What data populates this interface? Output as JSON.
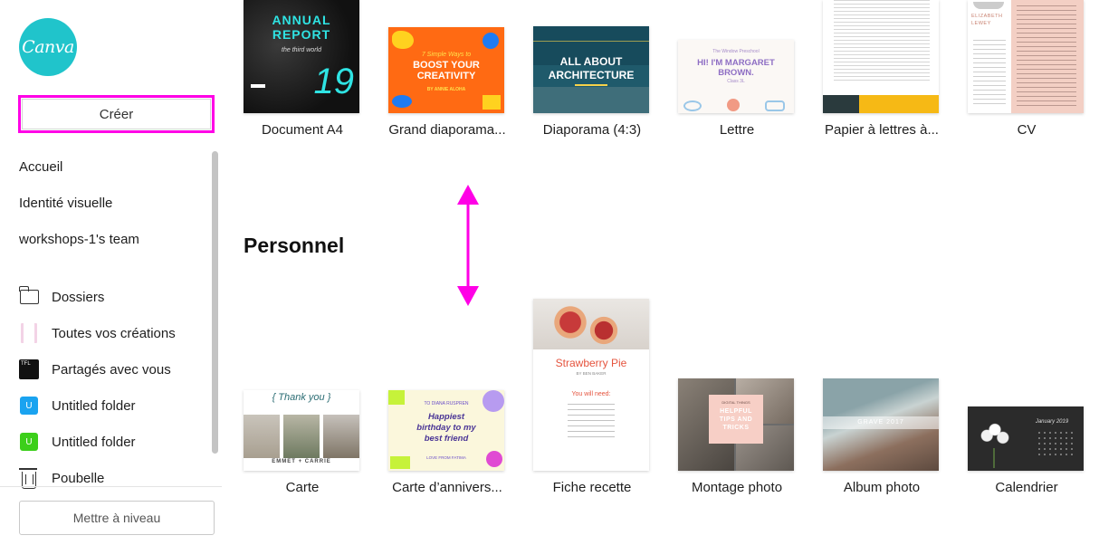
{
  "sidebar": {
    "logo_text": "Canva",
    "create_label": "Créer",
    "nav_top": [
      "Accueil",
      "Identité visuelle",
      "workshops-1's team"
    ],
    "folders": [
      {
        "label": "Dossiers",
        "icon": "folder-icon"
      },
      {
        "label": "Toutes vos créations",
        "icon": "all-designs-icon"
      },
      {
        "label": "Partagés avec vous",
        "icon": "shared-icon"
      },
      {
        "label": "Untitled folder",
        "icon": "folder-u-blue-icon",
        "badge": "U"
      },
      {
        "label": "Untitled folder",
        "icon": "folder-u-green-icon",
        "badge": "U"
      },
      {
        "label": "Poubelle",
        "icon": "trash-icon"
      }
    ],
    "upgrade_label": "Mettre à niveau"
  },
  "main": {
    "top_row": [
      {
        "label": "Document A4",
        "thumb": {
          "line1": "ANNUAL",
          "line2": "REPORT",
          "line3": "the third world",
          "number": "19"
        }
      },
      {
        "label": "Grand diaporama...",
        "thumb": {
          "line1": "7 Simple Ways to",
          "line2": "BOOST YOUR CREATIVITY",
          "line3": "BY ANNIE ALOHA"
        }
      },
      {
        "label": "Diaporama (4:3)",
        "thumb": {
          "line1": "ALL ABOUT ARCHITECTURE"
        }
      },
      {
        "label": "Lettre",
        "thumb": {
          "line1": "The Window Preschool",
          "line2": "HI! I'M MARGARET BROWN.",
          "line3": "Class 3L"
        }
      },
      {
        "label": "Papier à lettres à...",
        "thumb": {}
      },
      {
        "label": "CV",
        "thumb": {
          "line1": "ELIZABETH LEWEY"
        }
      }
    ],
    "section_title": "Personnel",
    "bottom_row": [
      {
        "label": "Carte",
        "thumb": {
          "line1": "{ Thank you }",
          "line2": "EMMET + CARRIE"
        }
      },
      {
        "label": "Carte d’annivers...",
        "thumb": {
          "line1": "TO DIANA RUSPREN",
          "line2": "Happiest birthday to my best friend",
          "line3": "LOVE FROM FATIMA"
        }
      },
      {
        "label": "Fiche recette",
        "thumb": {
          "line1": "Strawberry Pie",
          "line2": "BY BEN BAKER",
          "line3": "You will need:"
        }
      },
      {
        "label": "Montage photo",
        "thumb": {
          "line1": "DIGITAL THINGS",
          "line2": "HELPFUL TIPS AND TRICKS"
        }
      },
      {
        "label": "Album photo",
        "thumb": {
          "line1": "GRAVE 2017"
        }
      },
      {
        "label": "Calendrier",
        "thumb": {
          "line1": "January 2019"
        }
      }
    ]
  },
  "colors": {
    "accent": "#ff00e6",
    "logo": "#20c4cb"
  }
}
